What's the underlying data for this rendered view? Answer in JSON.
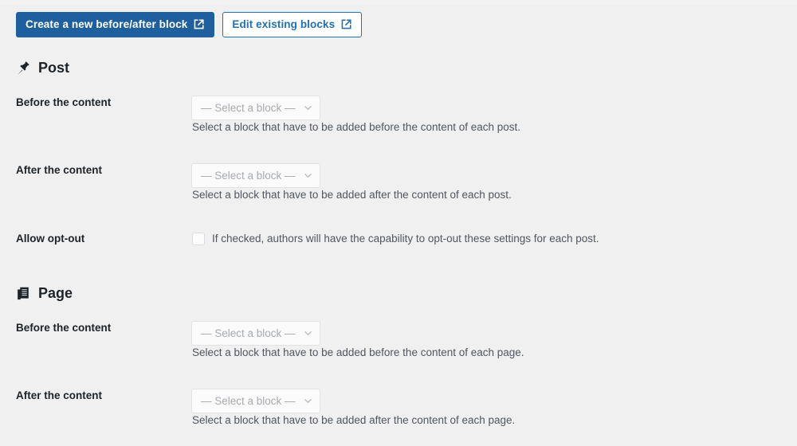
{
  "toolbar": {
    "create_button_label": "Create a new before/after block",
    "edit_button_label": "Edit existing blocks",
    "external_link_icon": "external-link-icon"
  },
  "colors": {
    "page_background": "#f0f0f1",
    "primary_button": "#1e5f9e",
    "secondary_button_text": "#2271b1",
    "label_text": "#1d2327",
    "description_text": "#50575e",
    "placeholder_text": "#a7aaad"
  },
  "sections": [
    {
      "id": "post",
      "icon": "pushpin-icon",
      "title": "Post",
      "rows": [
        {
          "id": "post-before-content",
          "label": "Before the content",
          "control": "select",
          "value": "— Select a block —",
          "description": "Select a block that have to be added before the content of each post."
        },
        {
          "id": "post-after-content",
          "label": "After the content",
          "control": "select",
          "value": "— Select a block —",
          "description": "Select a block that have to be added after the content of each post."
        },
        {
          "id": "post-allow-opt-out",
          "label": "Allow opt-out",
          "control": "checkbox",
          "checked": false,
          "description": "If checked, authors will have the capability to opt-out these settings for each post."
        }
      ]
    },
    {
      "id": "page",
      "icon": "pages-icon",
      "title": "Page",
      "rows": [
        {
          "id": "page-before-content",
          "label": "Before the content",
          "control": "select",
          "value": "— Select a block —",
          "description": "Select a block that have to be added before the content of each page."
        },
        {
          "id": "page-after-content",
          "label": "After the content",
          "control": "select",
          "value": "— Select a block —",
          "description": "Select a block that have to be added after the content of each page."
        }
      ]
    }
  ]
}
